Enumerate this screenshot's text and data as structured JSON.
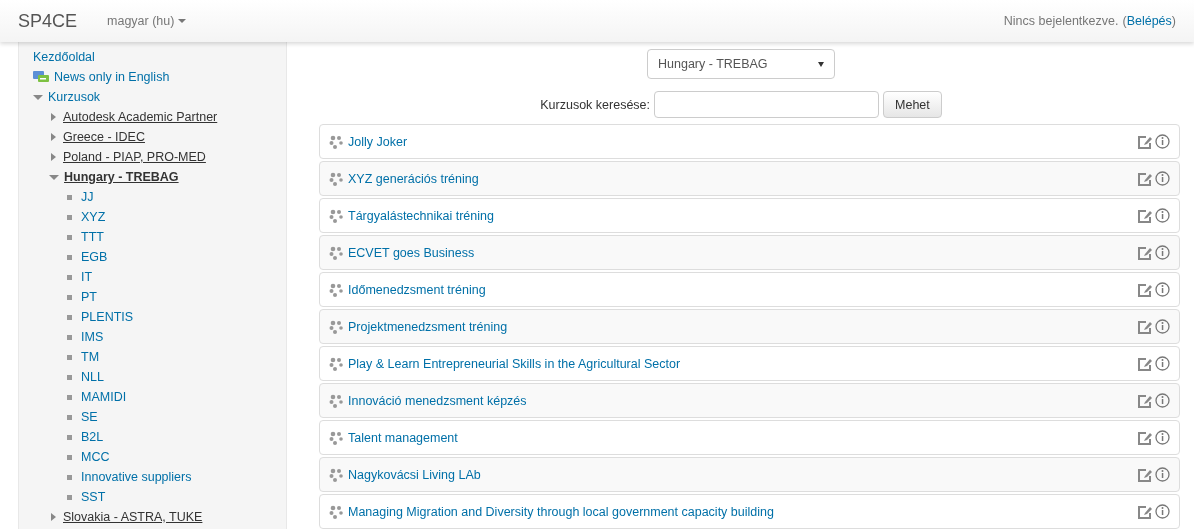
{
  "header": {
    "brand": "SP4CE",
    "language": "magyar (hu)",
    "login_status": "Nincs bejelentkezve.",
    "link_open": "(",
    "login_link": "Belépés",
    "link_close": ")"
  },
  "sidebar": {
    "items": [
      {
        "label": "Kezdőoldal",
        "kind": "link"
      },
      {
        "label": "News only in English",
        "kind": "forum"
      },
      {
        "label": "Kurzusok",
        "kind": "branch",
        "expanded": true,
        "children": [
          {
            "label": "Autodesk Academic Partner",
            "kind": "category",
            "expanded": false
          },
          {
            "label": "Greece - IDEC",
            "kind": "category",
            "expanded": false
          },
          {
            "label": "Poland - PIAP, PRO-MED",
            "kind": "category",
            "expanded": false
          },
          {
            "label": "Hungary - TREBAG",
            "kind": "category",
            "expanded": true,
            "children": [
              {
                "label": "JJ",
                "kind": "course"
              },
              {
                "label": "XYZ",
                "kind": "course"
              },
              {
                "label": "TTT",
                "kind": "course"
              },
              {
                "label": "EGB",
                "kind": "course"
              },
              {
                "label": "IT",
                "kind": "course"
              },
              {
                "label": "PT",
                "kind": "course"
              },
              {
                "label": "PLENTIS",
                "kind": "course"
              },
              {
                "label": "IMS",
                "kind": "course"
              },
              {
                "label": "TM",
                "kind": "course"
              },
              {
                "label": "NLL",
                "kind": "course"
              },
              {
                "label": "MAMIDI",
                "kind": "course"
              },
              {
                "label": "SE",
                "kind": "course"
              },
              {
                "label": "B2L",
                "kind": "course"
              },
              {
                "label": "MCC",
                "kind": "course"
              },
              {
                "label": "Innovative suppliers",
                "kind": "course"
              },
              {
                "label": "SST",
                "kind": "course"
              }
            ]
          },
          {
            "label": "Slovakia - ASTRA, TUKE",
            "kind": "category",
            "expanded": false
          }
        ]
      }
    ]
  },
  "category_select": {
    "value": "Hungary - TREBAG"
  },
  "course_search": {
    "label": "Kurzusok keresése:",
    "button": "Mehet"
  },
  "courses": [
    {
      "name": "Jolly Joker"
    },
    {
      "name": "XYZ generációs tréning"
    },
    {
      "name": "Tárgyalástechnikai tréning"
    },
    {
      "name": "ECVET goes Business"
    },
    {
      "name": "Időmenedzsment tréning"
    },
    {
      "name": "Projektmenedzsment tréning"
    },
    {
      "name": "Play & Learn Entrepreneurial Skills in the Agricultural Sector"
    },
    {
      "name": "Innováció menedzsment képzés"
    },
    {
      "name": "Talent management"
    },
    {
      "name": "Nagykovácsi Living LAb"
    },
    {
      "name": "Managing Migration and Diversity through local government capacity building"
    }
  ]
}
